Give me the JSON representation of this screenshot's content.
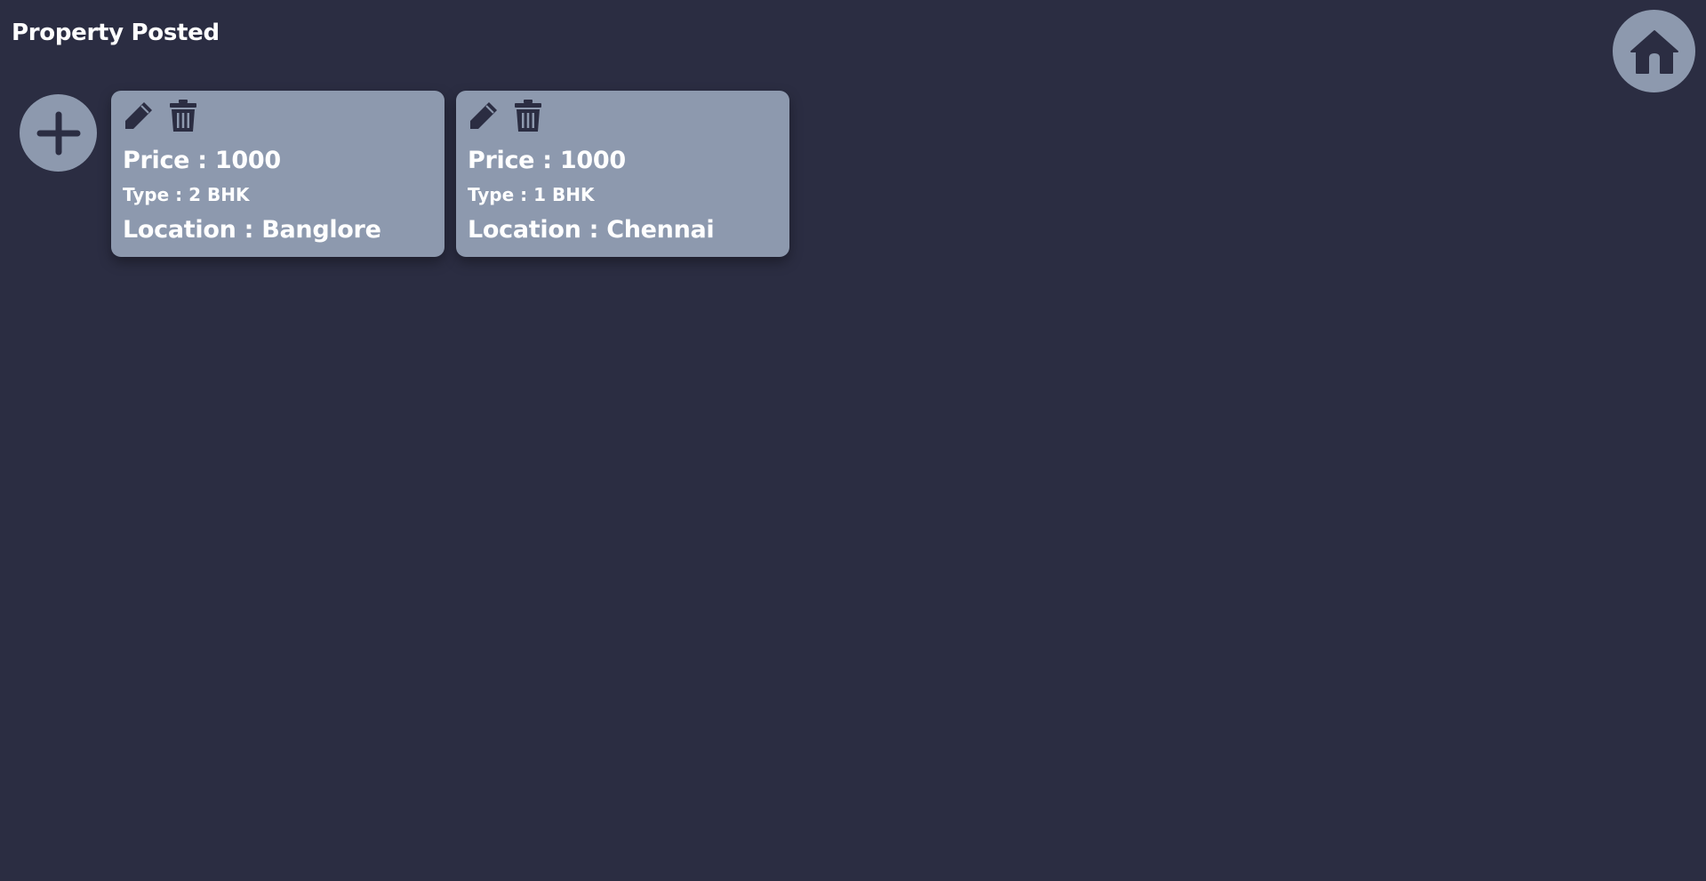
{
  "header": {
    "title": "Property Posted"
  },
  "icons": {
    "home": "home-icon",
    "add": "plus-icon",
    "edit": "pencil-icon",
    "delete": "trash-icon"
  },
  "colors": {
    "background": "#2b2d42",
    "card": "#8d99ae",
    "icon": "#2b2d42",
    "text": "#ffffff"
  },
  "properties": [
    {
      "price": "Price : 1000",
      "type": "Type : 2 BHK",
      "location": "Location : Banglore"
    },
    {
      "price": "Price : 1000",
      "type": "Type : 1 BHK",
      "location": "Location : Chennai"
    }
  ]
}
